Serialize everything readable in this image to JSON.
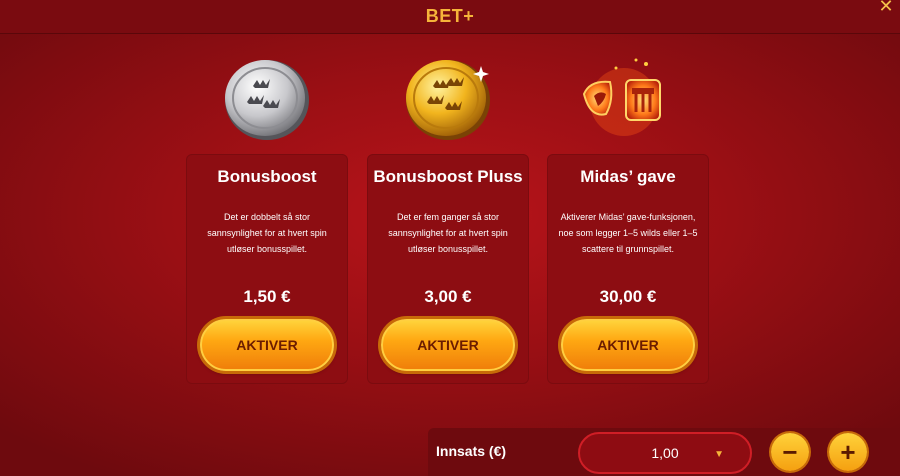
{
  "header": {
    "title": "BET+"
  },
  "cards": [
    {
      "title": "Bonusboost",
      "description": "Det er dobbelt så stor sannsynlighet for at hvert spin utløser bonusspillet.",
      "price": "1,50 €",
      "button": "AKTIVER",
      "icon": "silver-coin-icon"
    },
    {
      "title": "Bonusboost Pluss",
      "description": "Det er fem ganger så stor sannsynlighet for at hvert spin utløser bonusspillet.",
      "price": "3,00 €",
      "button": "AKTIVER",
      "icon": "gold-coin-icon"
    },
    {
      "title": "Midas’ gave",
      "description": "Aktiverer Midas’ gave-funksjonen, noe som legger 1–5 wilds eller 1–5 scattere til grunnspillet.",
      "price": "30,00 €",
      "button": "AKTIVER",
      "icon": "midas-gift-icon"
    }
  ],
  "stake": {
    "label": "Innsats (€)",
    "value": "1,00"
  },
  "colors": {
    "accent": "#f6b43a",
    "background": "#9a0f14",
    "button": "#ffa812"
  }
}
